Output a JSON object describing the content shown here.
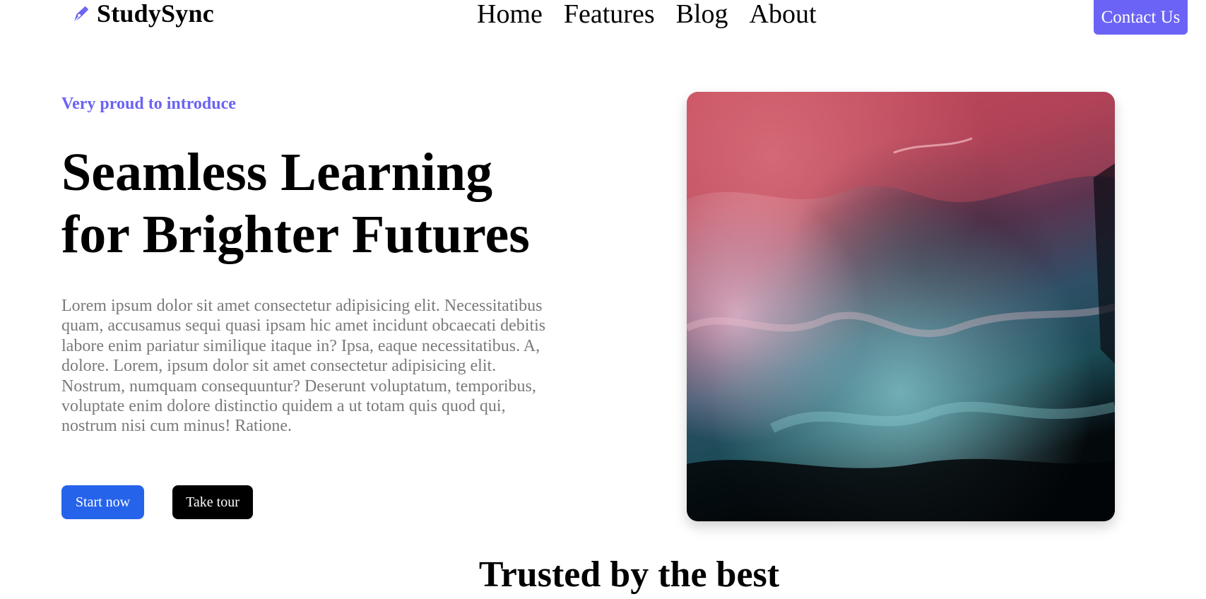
{
  "header": {
    "brand": {
      "name": "StudySync",
      "icon": "pen-nib-icon"
    },
    "nav": [
      "Home",
      "Features",
      "Blog",
      "About"
    ],
    "contact_label": "Contact Us"
  },
  "hero": {
    "eyebrow": "Very proud to introduce",
    "title": "Seamless Learning for Brighter Futures",
    "description": "Lorem ipsum dolor sit amet consectetur adipisicing elit. Necessitatibus quam, accusamus sequi quasi ipsam hic amet incidunt obcaecati debitis labore enim pariatur similique itaque in? Ipsa, eaque necessitatibus. A, dolore. Lorem, ipsum dolor sit amet consectetur adipisicing elit. Nostrum, numquam consequuntur? Deserunt voluptatum, temporibus, voluptate enim dolore distinctio quidem a ut totam quis quod qui, nostrum nisi cum minus! Ratione.",
    "buttons": {
      "primary": "Start now",
      "secondary": "Take tour"
    }
  },
  "trusted": {
    "heading": "Trusted by the best"
  },
  "colors": {
    "accent": "#6b63f5",
    "primary_button": "#2563eb",
    "dark_button": "#000000",
    "muted_text": "#7a7a7a"
  }
}
